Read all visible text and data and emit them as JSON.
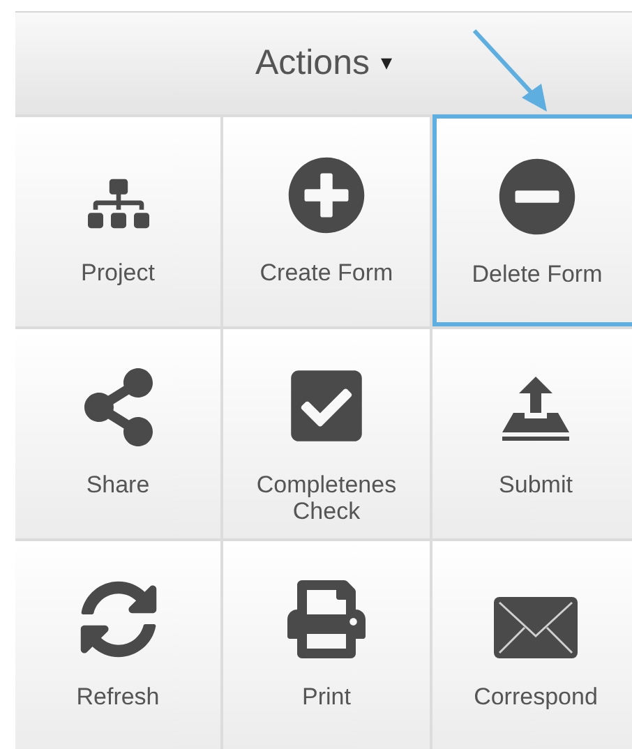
{
  "header": {
    "title": "Actions",
    "caret": "▾"
  },
  "items": [
    {
      "kind": "sitemap",
      "lines": [
        "Project"
      ],
      "highlighted": false
    },
    {
      "kind": "plus",
      "lines": [
        "Create Form"
      ],
      "highlighted": false
    },
    {
      "kind": "minus",
      "lines": [
        "Delete Form"
      ],
      "highlighted": true
    },
    {
      "kind": "share",
      "lines": [
        "Share"
      ],
      "highlighted": false
    },
    {
      "kind": "check",
      "lines": [
        "Completenes",
        "Check"
      ],
      "highlighted": false
    },
    {
      "kind": "upload",
      "lines": [
        "Submit"
      ],
      "highlighted": false
    },
    {
      "kind": "refresh",
      "lines": [
        "Refresh"
      ],
      "highlighted": false
    },
    {
      "kind": "print",
      "lines": [
        "Print"
      ],
      "highlighted": false
    },
    {
      "kind": "mail",
      "lines": [
        "Correspond"
      ],
      "highlighted": false
    }
  ]
}
